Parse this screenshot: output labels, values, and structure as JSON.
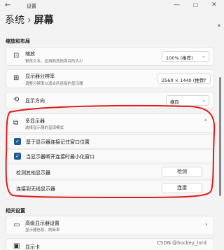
{
  "window": {
    "app_title": "设置",
    "min_icon": "minimize-icon",
    "max_icon": "maximize-icon",
    "close_icon": "close-icon"
  },
  "breadcrumb": {
    "parent": "系统",
    "separator": "›",
    "current": "屏幕"
  },
  "sections": {
    "scale_layout": "缩放和布局",
    "related": "相关设置"
  },
  "scale": {
    "title": "缩放",
    "subtitle": "更改文本、应用和其他项目的大小",
    "value": "100% (推荐)"
  },
  "resolution": {
    "title": "显示器分辨率",
    "subtitle": "调整分辨率以适合所连接的显示器",
    "value": "2560 × 1440 (推荐)"
  },
  "orientation": {
    "title": "显示方向",
    "value": "横向"
  },
  "multi_display": {
    "title": "多显示器",
    "subtitle": "选择显示器的呈现模式",
    "option1": "基于显示器连接记住窗口位置",
    "option1_checked": true,
    "option2": "当显示器断开连接时最小化窗口",
    "option2_checked": true,
    "detect_label": "检测其他显示器",
    "detect_button": "检测",
    "wireless_label": "连接到无线显示器",
    "wireless_button": "连接"
  },
  "related": {
    "advanced_title": "高级显示器设置",
    "advanced_subtitle": "显示器信息、刷新率",
    "graphics_title": "显示卡"
  },
  "colors": {
    "accent": "#1f5a99",
    "annotation": "#e01b1b"
  },
  "watermark": "CSDN @hockey_lord"
}
